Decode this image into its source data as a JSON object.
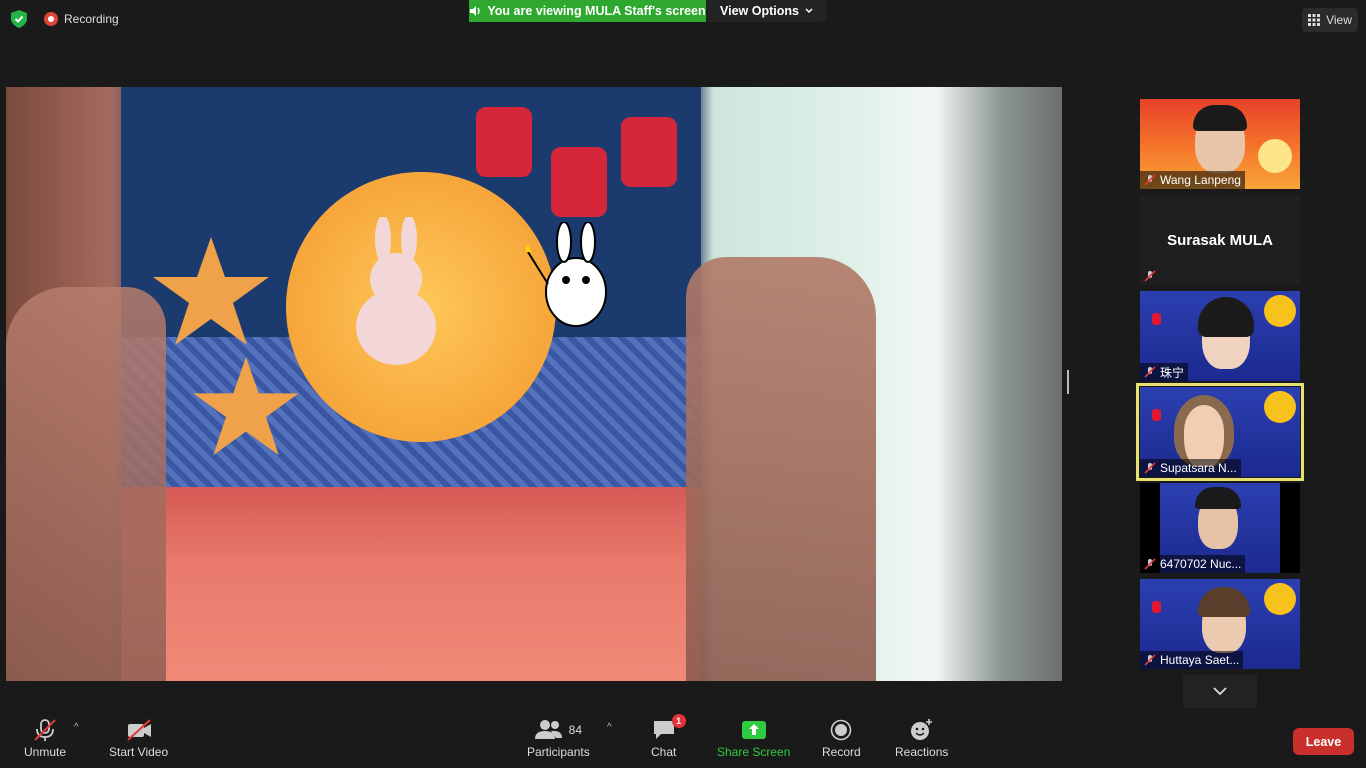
{
  "top": {
    "recording_label": "Recording",
    "viewing_label": "You are viewing MULA Staff's screen",
    "view_options_label": "View Options",
    "view_label": "View"
  },
  "gallery": {
    "tiles": [
      {
        "name": "Wang Lanpeng"
      },
      {
        "name": "Surasak MULA"
      },
      {
        "name": "珠宁"
      },
      {
        "name": "Supatsara N..."
      },
      {
        "name": "6470702 Nuc..."
      },
      {
        "name": "Huttaya Saet..."
      }
    ]
  },
  "toolbar": {
    "unmute_label": "Unmute",
    "start_video_label": "Start Video",
    "participants_label": "Participants",
    "participants_count": "84",
    "chat_label": "Chat",
    "chat_badge": "1",
    "share_screen_label": "Share Screen",
    "record_label": "Record",
    "reactions_label": "Reactions",
    "leave_label": "Leave"
  },
  "colors": {
    "share_banner": "#2ea82e",
    "leave": "#c9302c",
    "active_speaker_border": "#e8e070",
    "share_screen_icon": "#2ecc40"
  }
}
